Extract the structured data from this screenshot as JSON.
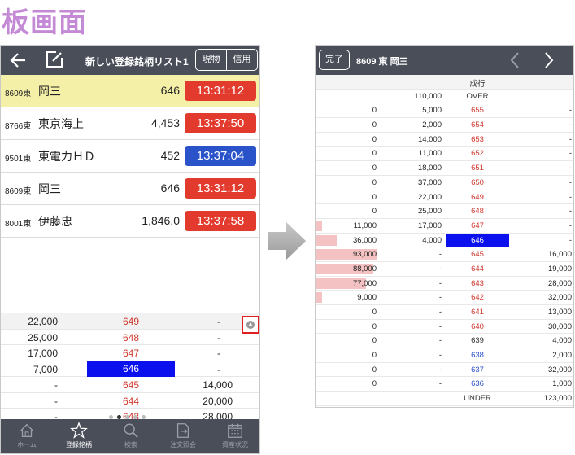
{
  "page_title": "板画面",
  "left": {
    "header": {
      "title": "新しい登録銘柄リスト1",
      "seg_spot": "現物",
      "seg_margin": "信用"
    },
    "stocks": [
      {
        "code": "8609東",
        "name": "岡三",
        "price": "646",
        "time": "13:31:12",
        "color": "red",
        "selected": true
      },
      {
        "code": "8766東",
        "name": "東京海上",
        "price": "4,453",
        "time": "13:37:50",
        "color": "red",
        "selected": false
      },
      {
        "code": "9501東",
        "name": "東電力ＨＤ",
        "price": "452",
        "time": "13:37:04",
        "color": "blue",
        "selected": false
      },
      {
        "code": "8609東",
        "name": "岡三",
        "price": "646",
        "time": "13:31:12",
        "color": "red",
        "selected": false
      },
      {
        "code": "8001東",
        "name": "伊藤忠",
        "price": "1,846.0",
        "time": "13:37:58",
        "color": "red",
        "selected": false
      }
    ],
    "mini_board": [
      {
        "buy": "22,000",
        "price": "649",
        "sell": "-"
      },
      {
        "buy": "25,000",
        "price": "648",
        "sell": "-"
      },
      {
        "buy": "17,000",
        "price": "647",
        "sell": "-"
      },
      {
        "buy": "7,000",
        "price": "646",
        "sell": "-",
        "current": true
      },
      {
        "buy": "-",
        "price": "645",
        "sell": "14,000"
      },
      {
        "buy": "-",
        "price": "644",
        "sell": "20,000"
      },
      {
        "buy": "-",
        "price": "643",
        "sell": "28,000"
      }
    ],
    "tabs": [
      {
        "label": "ホーム",
        "icon": "home-icon",
        "active": false
      },
      {
        "label": "登録銘柄",
        "icon": "star-icon",
        "active": true
      },
      {
        "label": "検索",
        "icon": "search-icon",
        "active": false
      },
      {
        "label": "注文照会",
        "icon": "order-icon",
        "active": false
      },
      {
        "label": "資産状況",
        "icon": "calendar-icon",
        "active": false
      }
    ]
  },
  "right": {
    "header": {
      "done": "完了",
      "title": "8609 東 岡三"
    },
    "board": [
      {
        "buy": "",
        "sell": "",
        "price": "成行",
        "price_color": "black",
        "buy2": "",
        "bar": 0
      },
      {
        "buy": "",
        "sell": "110,000",
        "price": "OVER",
        "price_color": "black",
        "buy2": "",
        "bar": 0
      },
      {
        "buy": "0",
        "sell": "5,000",
        "price": "655",
        "price_color": "red",
        "buy2": "-",
        "bar": 0
      },
      {
        "buy": "0",
        "sell": "2,000",
        "price": "654",
        "price_color": "red",
        "buy2": "-",
        "bar": 0
      },
      {
        "buy": "0",
        "sell": "14,000",
        "price": "653",
        "price_color": "red",
        "buy2": "-",
        "bar": 0
      },
      {
        "buy": "0",
        "sell": "11,000",
        "price": "652",
        "price_color": "red",
        "buy2": "-",
        "bar": 0
      },
      {
        "buy": "0",
        "sell": "18,000",
        "price": "651",
        "price_color": "red",
        "buy2": "-",
        "bar": 0
      },
      {
        "buy": "0",
        "sell": "37,000",
        "price": "650",
        "price_color": "red",
        "buy2": "-",
        "bar": 0
      },
      {
        "buy": "0",
        "sell": "22,000",
        "price": "649",
        "price_color": "red",
        "buy2": "-",
        "bar": 0
      },
      {
        "buy": "0",
        "sell": "25,000",
        "price": "648",
        "price_color": "red",
        "buy2": "-",
        "bar": 0
      },
      {
        "buy": "11,000",
        "sell": "17,000",
        "price": "647",
        "price_color": "red",
        "buy2": "-",
        "bar": 0.1
      },
      {
        "buy": "36,000",
        "sell": "4,000",
        "price": "646",
        "price_color": "white",
        "buy2": "-",
        "bar": 0.35,
        "current": true
      },
      {
        "buy": "93,000",
        "sell": "-",
        "price": "645",
        "price_color": "red",
        "buy2": "16,000",
        "bar": 1.0
      },
      {
        "buy": "88,000",
        "sell": "-",
        "price": "644",
        "price_color": "red",
        "buy2": "19,000",
        "bar": 0.95
      },
      {
        "buy": "77,000",
        "sell": "-",
        "price": "643",
        "price_color": "red",
        "buy2": "28,000",
        "bar": 0.83
      },
      {
        "buy": "9,000",
        "sell": "-",
        "price": "642",
        "price_color": "red",
        "buy2": "32,000",
        "bar": 0.1
      },
      {
        "buy": "0",
        "sell": "-",
        "price": "641",
        "price_color": "red",
        "buy2": "13,000",
        "bar": 0
      },
      {
        "buy": "0",
        "sell": "-",
        "price": "640",
        "price_color": "red",
        "buy2": "30,000",
        "bar": 0
      },
      {
        "buy": "0",
        "sell": "-",
        "price": "639",
        "price_color": "black",
        "buy2": "4,000",
        "bar": 0
      },
      {
        "buy": "0",
        "sell": "-",
        "price": "638",
        "price_color": "blue",
        "buy2": "2,000",
        "bar": 0
      },
      {
        "buy": "0",
        "sell": "-",
        "price": "637",
        "price_color": "blue",
        "buy2": "32,000",
        "bar": 0
      },
      {
        "buy": "0",
        "sell": "-",
        "price": "636",
        "price_color": "blue",
        "buy2": "1,000",
        "bar": 0
      },
      {
        "buy": "",
        "sell": "",
        "price": "UNDER",
        "price_color": "black",
        "buy2": "123,000",
        "bar": 0
      }
    ]
  }
}
